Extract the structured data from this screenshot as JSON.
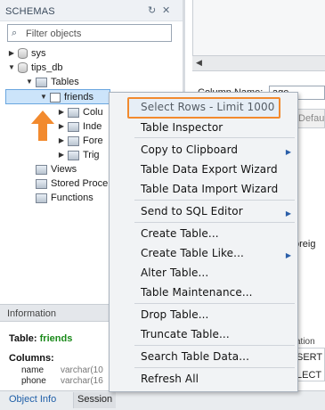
{
  "navigator": {
    "title": "SCHEMAS",
    "filter_placeholder": "Filter objects",
    "tree": {
      "sys": "sys",
      "tips_db": "tips_db",
      "tables": "Tables",
      "friends": "friends",
      "columns": "Colu",
      "indexes": "Inde",
      "foreign_keys": "Fore",
      "triggers": "Trig",
      "views": "Views",
      "stored_procedures": "Stored Proce",
      "functions": "Functions"
    }
  },
  "right_pane": {
    "column_name_label": "Column Name:",
    "column_name_value": "age",
    "default_label": "Defau",
    "foreign_label": "oreig",
    "action_label": "ation",
    "row1": "SERT",
    "row2": "LECT"
  },
  "info_panel": {
    "header": "Information",
    "table_label": "Table:",
    "table_name": "friends",
    "columns_label": "Columns:",
    "columns": [
      {
        "name": "name",
        "type": "varchar(10"
      },
      {
        "name": "phone",
        "type": "varchar(16"
      }
    ]
  },
  "bottom_tabs": {
    "object_info": "Object Info",
    "session": "Session"
  },
  "context_menu": {
    "items": [
      "Select Rows - Limit 1000",
      "Table Inspector",
      "Copy to Clipboard",
      "Table Data Export Wizard",
      "Table Data Import Wizard",
      "Send to SQL Editor",
      "Create Table...",
      "Create Table Like...",
      "Alter Table...",
      "Table Maintenance...",
      "Drop Table...",
      "Truncate Table...",
      "Search Table Data...",
      "Refresh All"
    ]
  },
  "colors": {
    "highlight_border": "#f28a2e",
    "selection_bg": "#cce4fa",
    "table_name_green": "#1a8a1a",
    "submenu_arrow": "#2a5ea8"
  }
}
